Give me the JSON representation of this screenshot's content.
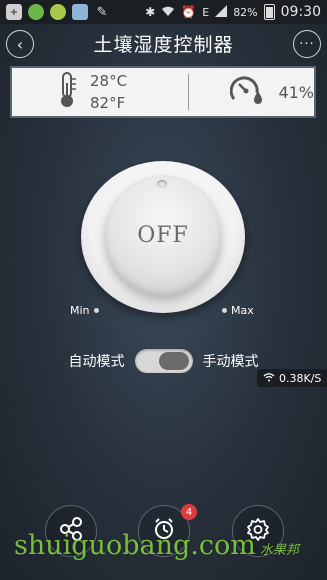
{
  "status_bar": {
    "network_type": "E",
    "battery": "82%",
    "time": "09:30"
  },
  "header": {
    "title": "土壤湿度控制器",
    "more_label": "···"
  },
  "sensors": {
    "temp_c": "28°C",
    "temp_f": "82°F",
    "humidity": "41%"
  },
  "dial": {
    "state_label": "OFF",
    "min_label": "Min",
    "max_label": "Max"
  },
  "mode": {
    "auto_label": "自动模式",
    "manual_label": "手动模式",
    "manual_selected": true
  },
  "network_speed": "0.38K/S",
  "bottom_nav": {
    "alarm_badge": "4"
  },
  "watermark": {
    "text": "shuiguobang",
    "suffix": ".com",
    "cn_text": "水果邦"
  }
}
